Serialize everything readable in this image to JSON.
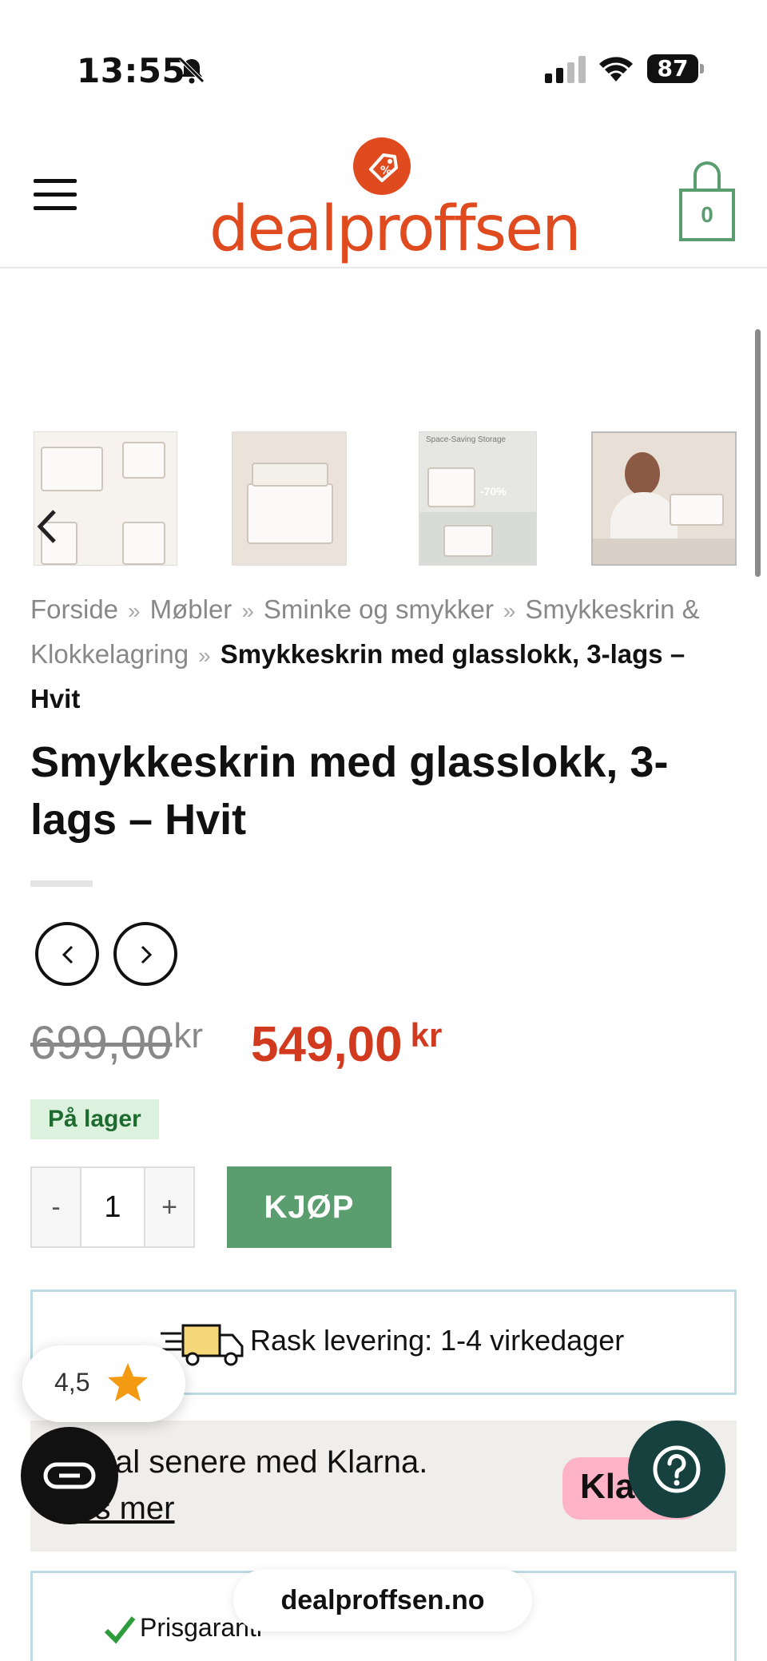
{
  "status_bar": {
    "time": "13:55",
    "battery": "87",
    "icons": [
      "bell-slash-icon",
      "signal-icon",
      "wifi-icon",
      "battery-icon"
    ]
  },
  "header": {
    "logo_text": "dealproffsen",
    "cart_count": "0",
    "icons": [
      "menu-icon",
      "cart-icon"
    ]
  },
  "gallery": {
    "thumbnails": [
      "dimensions",
      "open-box",
      "Space-Saving Storage",
      "woman-with-box"
    ],
    "thumb_3_text": "Space-Saving Storage",
    "thumb_3_badge": "-70%",
    "prev_icon": "chevron-left-icon"
  },
  "breadcrumb": {
    "items": [
      "Forside",
      "Møbler",
      "Sminke og smykker",
      "Smykkeskrin & Klokkelagring"
    ],
    "separator": "»",
    "current": "Smykkeskrin med glasslokk, 3-lags – Hvit"
  },
  "product": {
    "title": "Smykkeskrin med glasslokk, 3-lags – Hvit",
    "old_price": "699,00",
    "new_price": "549,00",
    "currency": "kr",
    "stock": "På lager",
    "quantity": "1",
    "qty_minus": "-",
    "qty_plus": "+",
    "buy_label": "KJØP"
  },
  "delivery": {
    "text": "Rask levering: 1-4 virkedager"
  },
  "klarna": {
    "text": "Betal senere med Klarna.",
    "link": "Les mer",
    "badge": "Klarna."
  },
  "guarantee": {
    "text": "Prisgaranti"
  },
  "floating": {
    "rating": "4,5",
    "url": "dealproffsen.no"
  },
  "colors": {
    "brand": "#e04a1f",
    "accent_green": "#5a9d6f",
    "sale_red": "#d13a1e",
    "stock_bg": "#dcf1de",
    "klarna_pink": "#ffb3c7",
    "help_bg": "#17413f"
  }
}
